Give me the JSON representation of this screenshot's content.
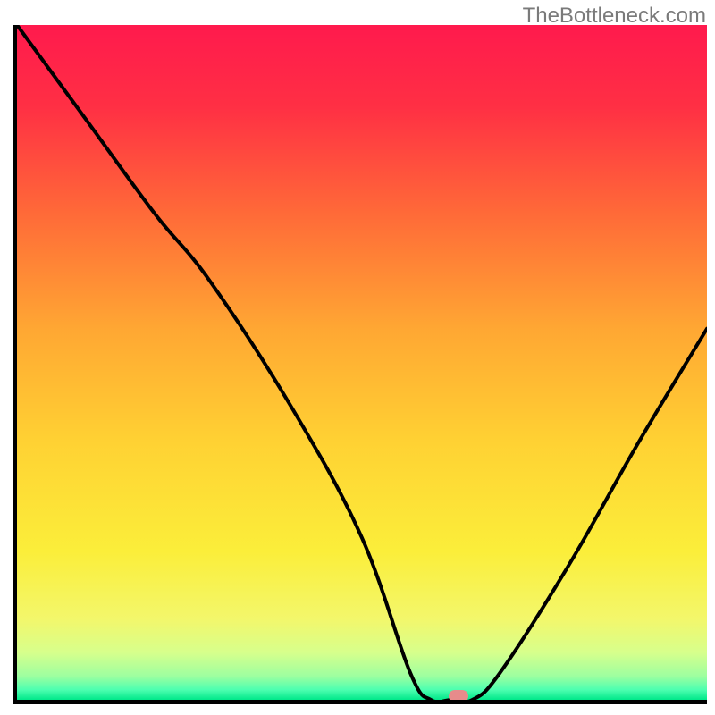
{
  "watermark": "TheBottleneck.com",
  "chart_data": {
    "type": "line",
    "title": "",
    "xlabel": "",
    "ylabel": "",
    "xlim": [
      0,
      100
    ],
    "ylim": [
      0,
      100
    ],
    "x": [
      0,
      10,
      20,
      28,
      40,
      50,
      57,
      60,
      63,
      66,
      70,
      80,
      90,
      100
    ],
    "values": [
      100,
      86,
      72,
      62,
      43,
      24,
      4,
      0,
      0,
      0,
      4,
      20,
      38,
      55
    ],
    "description": "V-shaped bottleneck curve: descends from top-left, inflects near x≈28, reaches zero around x≈60–66, then rises toward right.",
    "marker": {
      "x": 64,
      "y": 0,
      "color": "#e78b8b"
    },
    "background_gradient": [
      "#ff1744",
      "#ff7a33",
      "#ffd233",
      "#fff26b",
      "#b6ff9a",
      "#00e676"
    ],
    "axes": {
      "left": true,
      "bottom": true,
      "grid": false
    }
  }
}
